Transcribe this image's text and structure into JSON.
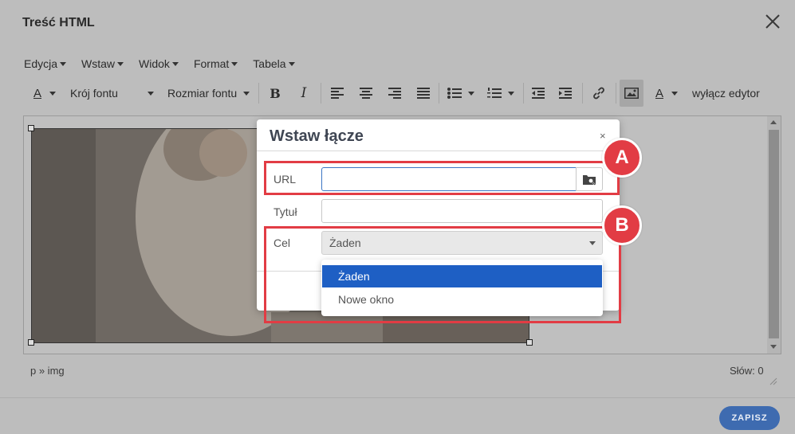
{
  "window": {
    "title": "Treść HTML"
  },
  "menubar": {
    "items": [
      {
        "label": "Edycja"
      },
      {
        "label": "Wstaw"
      },
      {
        "label": "Widok"
      },
      {
        "label": "Format"
      },
      {
        "label": "Tabela"
      }
    ]
  },
  "toolbar": {
    "text_color_letter": "A",
    "font_family_label": "Krój fontu",
    "font_size_label": "Rozmiar fontu",
    "bold_letter": "B",
    "italic_letter": "I",
    "bg_color_letter": "A",
    "disable_editor_label": "wyłącz edytor"
  },
  "statusbar": {
    "path": "p » img",
    "word_count": "Słów: 0"
  },
  "footer": {
    "save_label": "ZAPISZ"
  },
  "dialog": {
    "title": "Wstaw łącze",
    "close_symbol": "×",
    "url_label": "URL",
    "url_value": "",
    "title_label": "Tytuł",
    "title_value": "",
    "target_label": "Cel",
    "target_selected": "Żaden",
    "target_options": [
      {
        "label": "Żaden"
      },
      {
        "label": "Nowe okno"
      }
    ]
  },
  "annotations": {
    "a_label": "A",
    "b_label": "B",
    "color": "#e23c44"
  },
  "colors": {
    "accent": "#3e6bb0",
    "selected": "#1e5fc4"
  }
}
